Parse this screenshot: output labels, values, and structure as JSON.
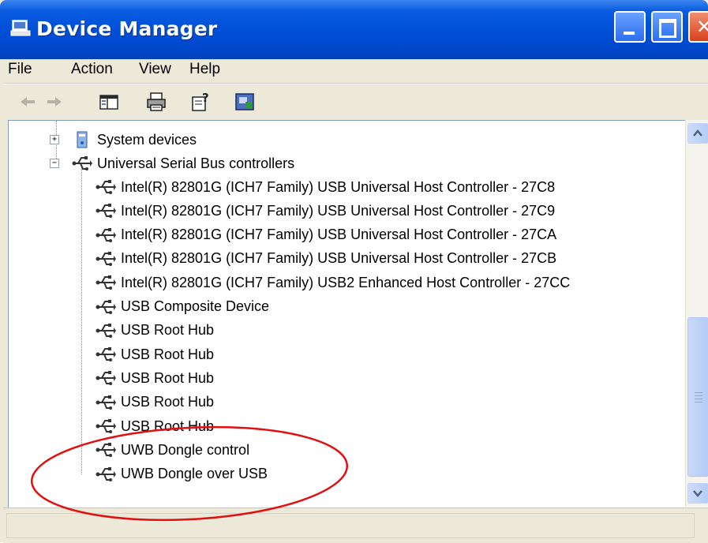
{
  "window": {
    "title": "Device Manager",
    "buttons": {
      "minimize": "minimize",
      "maximize": "maximize",
      "close": "close"
    }
  },
  "menubar": {
    "items": [
      "File",
      "Action",
      "View",
      "Help"
    ]
  },
  "toolbar": {
    "icons": [
      "back-arrow-icon",
      "forward-arrow-icon",
      "show-hide-console-tree-icon",
      "print-icon",
      "properties-icon",
      "help-icon"
    ]
  },
  "tree": {
    "system_devices": "System devices",
    "usb_controllers": "Universal Serial Bus controllers",
    "usb_children": [
      "Intel(R) 82801G (ICH7 Family) USB Universal Host Controller - 27C8",
      "Intel(R) 82801G (ICH7 Family) USB Universal Host Controller - 27C9",
      "Intel(R) 82801G (ICH7 Family) USB Universal Host Controller - 27CA",
      "Intel(R) 82801G (ICH7 Family) USB Universal Host Controller - 27CB",
      "Intel(R) 82801G (ICH7 Family) USB2 Enhanced Host Controller - 27CC",
      "USB Composite Device",
      "USB Root Hub",
      "USB Root Hub",
      "USB Root Hub",
      "USB Root Hub",
      "USB Root Hub",
      "UWB Dongle control",
      "UWB Dongle over USB"
    ],
    "expander_collapsed": "+",
    "expander_expanded": "−"
  },
  "colors": {
    "titlebar": "#0050d8",
    "annotation_ellipse": "#e01010",
    "background": "#ece9d8"
  }
}
